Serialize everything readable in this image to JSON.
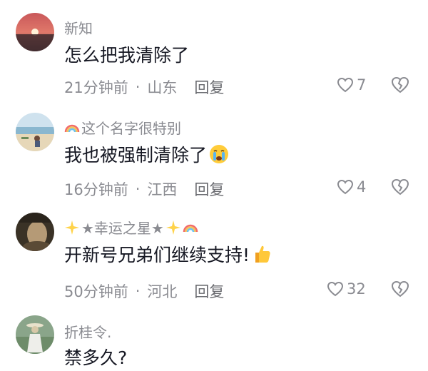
{
  "comments": [
    {
      "username": "新知",
      "text": "怎么把我清除了",
      "time": "21分钟前",
      "location": "山东",
      "reply": "回复",
      "likes": "7"
    },
    {
      "username": "这个名字很特别",
      "text": "我也被强制清除了",
      "time": "16分钟前",
      "location": "江西",
      "reply": "回复",
      "likes": "4",
      "icons": [
        "rainbow-icon",
        "crying-emoji-icon"
      ]
    },
    {
      "username_parts": [
        "★幸运之星★"
      ],
      "text": "开新号兄弟们继续支持!",
      "time": "50分钟前",
      "location": "河北",
      "reply": "回复",
      "likes": "32",
      "icons": [
        "sparkle-icon",
        "sparkle-icon",
        "rainbow-icon",
        "thumbs-up-emoji-icon"
      ]
    },
    {
      "username": "折桂令.",
      "text": "禁多久?"
    }
  ],
  "separator": "·"
}
